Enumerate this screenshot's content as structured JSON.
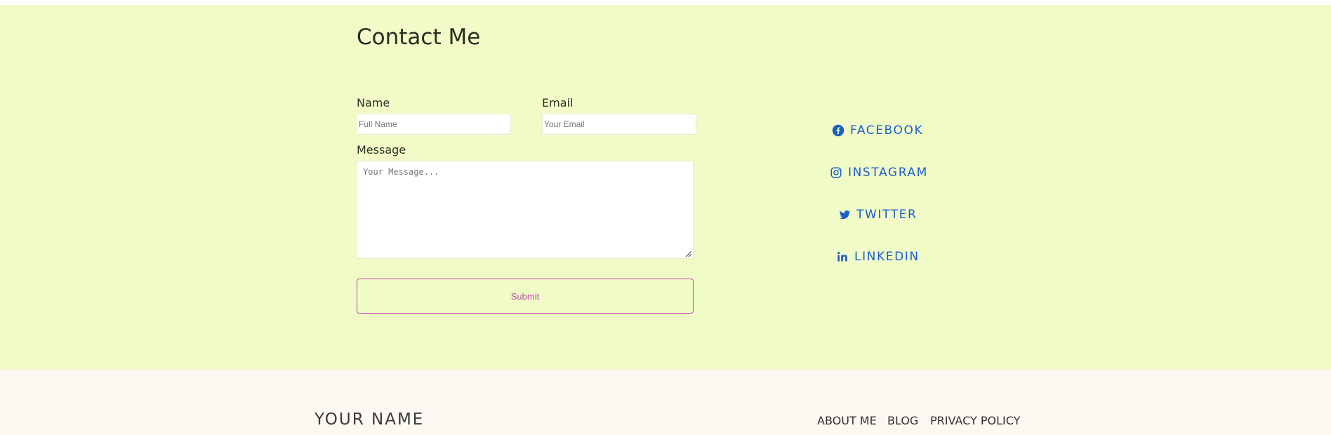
{
  "contact": {
    "title": "Contact Me",
    "name_label": "Name",
    "name_placeholder": "Full Name",
    "email_label": "Email",
    "email_placeholder": "Your Email",
    "message_label": "Message",
    "message_placeholder": "Your Message...",
    "submit_label": "Submit"
  },
  "social": [
    {
      "label": "FACEBOOK",
      "icon": "facebook-icon"
    },
    {
      "label": "INSTAGRAM",
      "icon": "instagram-icon"
    },
    {
      "label": "TWITTER",
      "icon": "twitter-icon"
    },
    {
      "label": "LINKEDIN",
      "icon": "linkedin-icon"
    }
  ],
  "footer": {
    "brand": "YOUR NAME",
    "nav": [
      "ABOUT ME",
      "BLOG",
      "PRIVACY POLICY"
    ]
  },
  "colors": {
    "section_bg": "#f0fbc8",
    "footer_bg": "#fdf8f2",
    "social_link": "#1d5fc9",
    "submit_accent": "#c24bb1"
  }
}
